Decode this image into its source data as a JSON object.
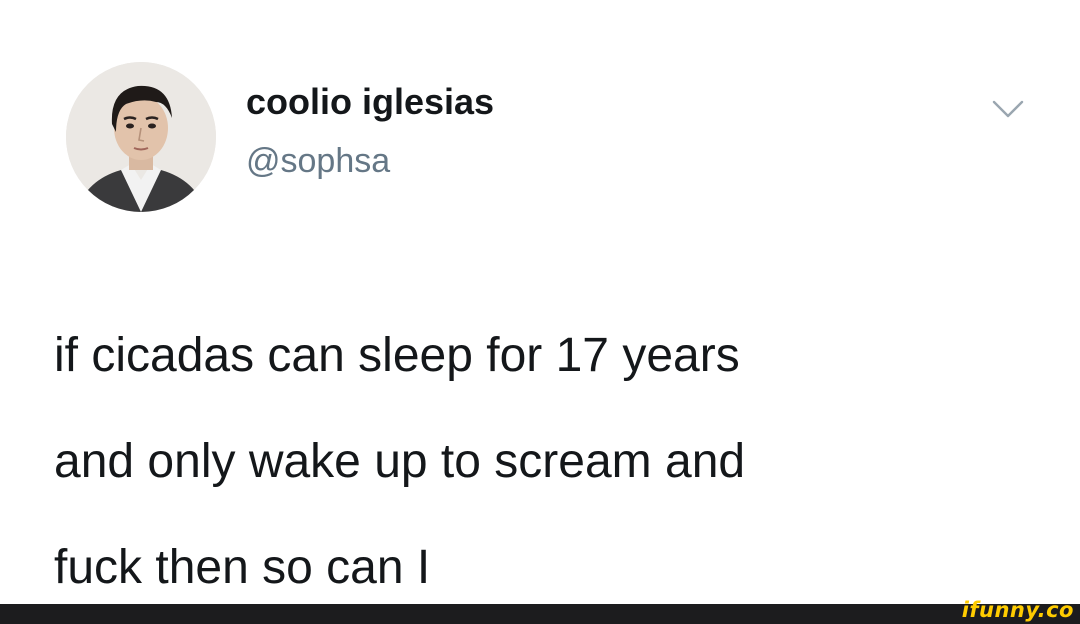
{
  "tweet": {
    "author": {
      "display_name": "coolio iglesias",
      "handle": "@sophsa"
    },
    "text_lines": [
      "if cicadas can sleep for 17 years",
      "and only wake up to scream and",
      "fuck then so can I"
    ],
    "menu_icon": "chevron-down-icon"
  },
  "watermark": {
    "text": "ifunny.co"
  },
  "colors": {
    "text_primary": "#14171a",
    "text_secondary": "#657786",
    "watermark": "#ffcc00",
    "footer_bar": "#1c1c1e"
  }
}
